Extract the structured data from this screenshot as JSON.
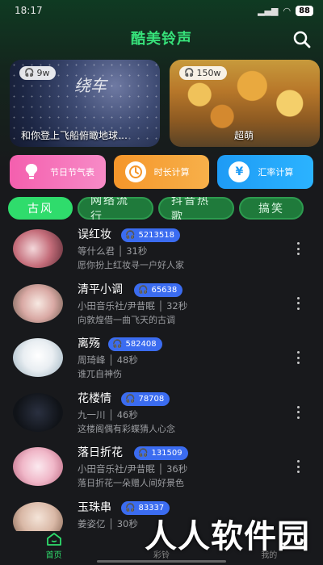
{
  "status_bar": {
    "time": "18:17",
    "battery": "88"
  },
  "header": {
    "title": "酷美铃声"
  },
  "banners": [
    {
      "plays": "9w",
      "script_text": "绕车",
      "caption": "和你登上飞船俯瞰地球…"
    },
    {
      "plays": "150w",
      "caption": "超萌"
    }
  ],
  "tools": [
    {
      "label": "节日节气表",
      "icon": "bulb-icon"
    },
    {
      "label": "时长计算",
      "icon": "clock-icon"
    },
    {
      "label": "汇率计算",
      "icon": "yen-icon",
      "glyph": "¥"
    }
  ],
  "tabs": [
    {
      "label": "古风",
      "active": true
    },
    {
      "label": "网络流行"
    },
    {
      "label": "抖音热歌"
    },
    {
      "label": "搞笑"
    }
  ],
  "songs": [
    {
      "title": "误红妆",
      "plays": "5213518",
      "meta": "等什么君 │ 31秒",
      "desc": "愿你扮上红妆寻一户好人家"
    },
    {
      "title": "清平小调",
      "plays": "65638",
      "meta": "小田音乐社/尹昔眠 │ 32秒",
      "desc": "向敦煌借一曲飞天的古调"
    },
    {
      "title": "离殇",
      "plays": "582408",
      "meta": "周琦峰 │ 48秒",
      "desc": "谁兀自神伤"
    },
    {
      "title": "花楼情",
      "plays": "78708",
      "meta": "九一川 │ 46秒",
      "desc": "这楼阁偶有彩蝶猜人心念"
    },
    {
      "title": "落日折花",
      "plays": "131509",
      "meta": "小田音乐社/尹昔眠 │ 36秒",
      "desc": "落日折花一朵赠人间好景色"
    },
    {
      "title": "玉珠串",
      "plays": "83337",
      "meta": "姜姿亿 │ 30秒",
      "desc": ""
    }
  ],
  "bottom_nav": [
    {
      "label": "首页",
      "active": true
    },
    {
      "label": "彩铃"
    },
    {
      "label": "我的"
    }
  ],
  "watermark": "人人软件园",
  "colors": {
    "accent": "#2fdc6c",
    "badge": "#3b6cf0",
    "title": "#37e27a"
  }
}
